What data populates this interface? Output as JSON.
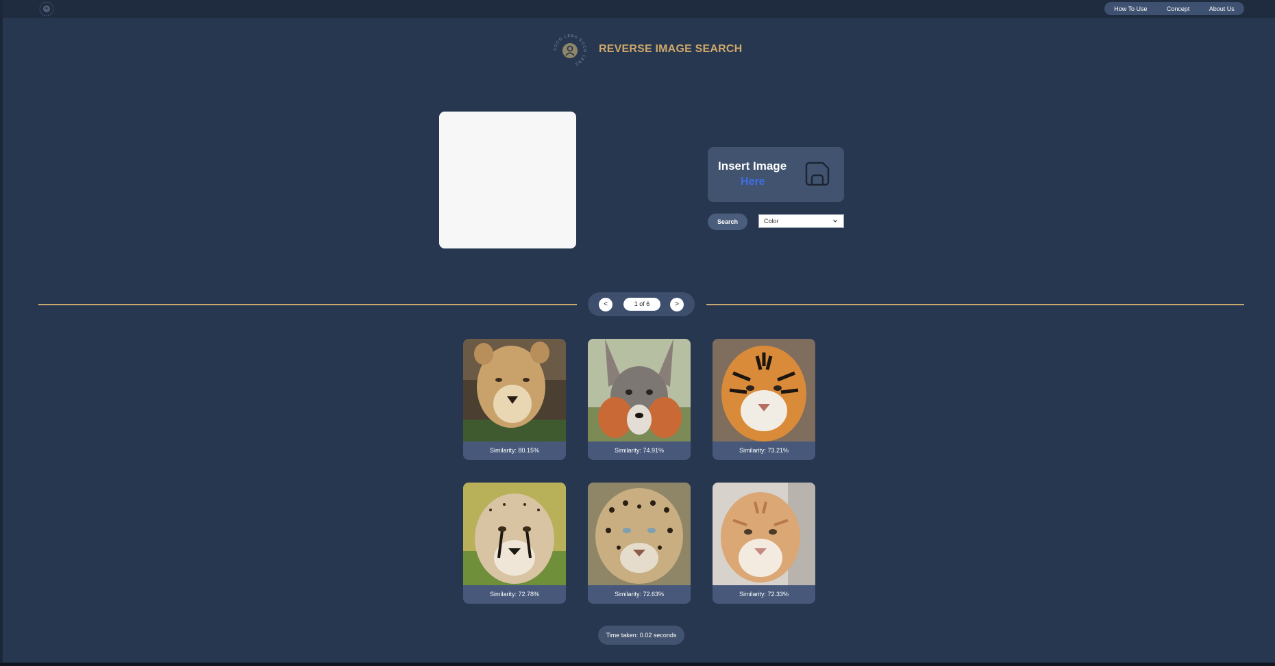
{
  "nav": {
    "items": [
      "How To Use",
      "Concept",
      "About Us"
    ]
  },
  "brand": {
    "title": "REVERSE IMAGE SEARCH",
    "ring_text": "SOCO LENS SOCO LENS"
  },
  "upload": {
    "title": "Insert Image",
    "here": "Here",
    "icon": "file-icon"
  },
  "search": {
    "button_label": "Search",
    "mode": "Color"
  },
  "pager": {
    "prev": "<",
    "next": ">",
    "status": "1 of 6"
  },
  "results": [
    {
      "animal": "lioness",
      "similarity": "Similarity: 80.15%"
    },
    {
      "animal": "fox",
      "similarity": "Similarity: 74.91%"
    },
    {
      "animal": "tiger",
      "similarity": "Similarity: 73.21%"
    },
    {
      "animal": "cheetah",
      "similarity": "Similarity: 72.78%"
    },
    {
      "animal": "leopard",
      "similarity": "Similarity: 72.63%"
    },
    {
      "animal": "golden-tiger",
      "similarity": "Similarity: 72.33%"
    }
  ],
  "footer": {
    "time_taken": "Time taken: 0.02 seconds"
  },
  "colors": {
    "background": "#273750",
    "accent_gold": "#c7a86e",
    "link_blue": "#3f6fe6",
    "card": "#47587a"
  }
}
